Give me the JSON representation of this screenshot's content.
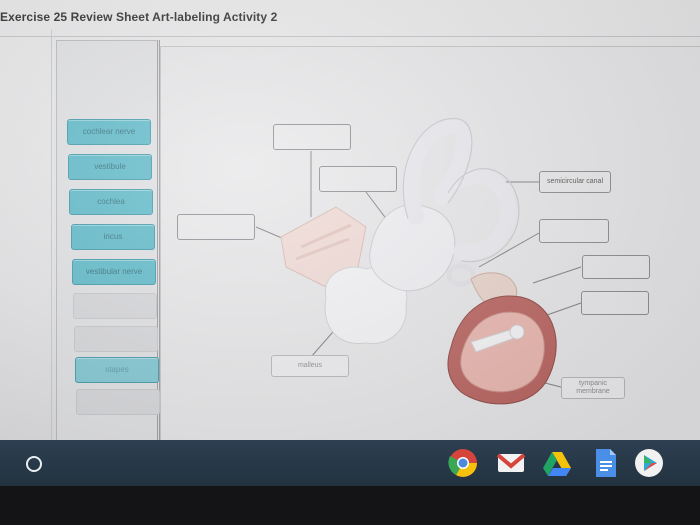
{
  "page": {
    "title": "Exercise 25 Review Sheet Art-labeling Activity 2"
  },
  "bank": {
    "items": [
      {
        "label": "cochlear nerve"
      },
      {
        "label": "vestibule"
      },
      {
        "label": "cochlea"
      },
      {
        "label": "incus"
      },
      {
        "label": "vestibular nerve"
      },
      {
        "label": ""
      },
      {
        "label": ""
      },
      {
        "label": "stapes"
      },
      {
        "label": ""
      }
    ]
  },
  "diagram": {
    "targets": [
      {
        "label": ""
      },
      {
        "label": ""
      },
      {
        "label": ""
      },
      {
        "label": "semicircular canal"
      },
      {
        "label": ""
      },
      {
        "label": ""
      },
      {
        "label": ""
      },
      {
        "label": "malleus"
      },
      {
        "label": "tympanic membrane"
      }
    ]
  },
  "taskbar": {
    "icons": [
      "launcher-icon",
      "chrome-icon",
      "gmail-icon",
      "drive-icon",
      "docs-icon",
      "play-store-icon"
    ]
  },
  "colors": {
    "chip_fill": "#5bb8c8",
    "taskbar": "#2d3f52",
    "bone": "#e8e8ec",
    "membrane": "#c98a86"
  }
}
